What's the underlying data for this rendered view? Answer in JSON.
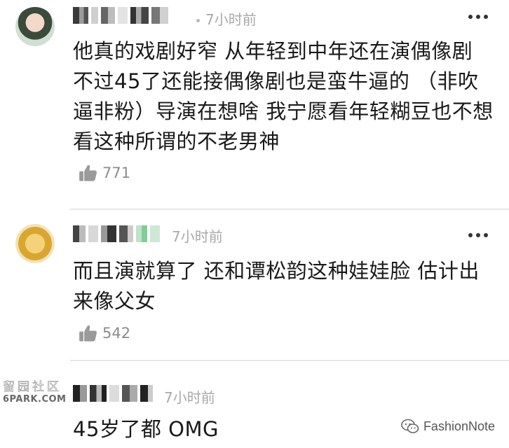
{
  "comments": [
    {
      "time": "7小时前",
      "text": "他真的戏剧好窄 从年轻到中年还在演偶像剧 不过45了还能接偶像剧也是蛮牛逼的 （非吹逼非粉）导演在想啥 我宁愿看年轻糊豆也不想看这种所谓的不老男神",
      "likes": "771"
    },
    {
      "time": "7小时前",
      "text": "而且演就算了 还和谭松韵这种娃娃脸 估计出来像父女",
      "likes": "542"
    },
    {
      "time": "7小时前",
      "text": "45岁了都 OMG"
    }
  ],
  "watermarks": {
    "left_top": "留园社区",
    "left_bottom": "6PARK.COM",
    "right": "FashionNote"
  },
  "icons": {
    "like": "thumbs-up-icon",
    "more": "more-dots-icon",
    "brand": "wechat-icon"
  },
  "colors": {
    "text": "#1a1a1a",
    "meta": "#a8a8a8",
    "divider": "#e6e6e6"
  }
}
